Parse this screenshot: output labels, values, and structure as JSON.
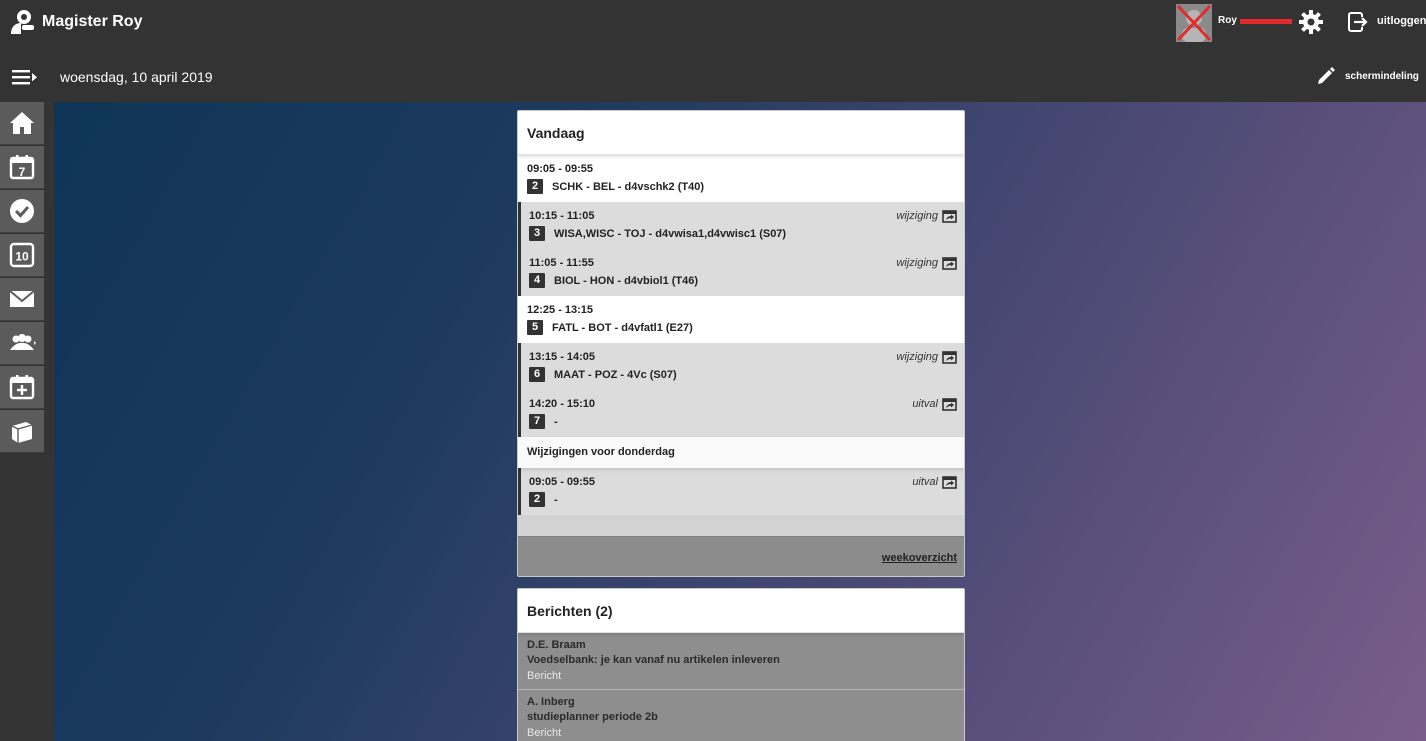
{
  "app": {
    "title": "Magister Roy"
  },
  "user": {
    "name": "Roy"
  },
  "header": {
    "logout_label": "uitloggen",
    "date": "woensdag, 10 april 2019",
    "layout_label": "schermindeling"
  },
  "sidebar": {
    "items": [
      {
        "icon": "home-icon"
      },
      {
        "icon": "calendar-7-icon"
      },
      {
        "icon": "check-icon"
      },
      {
        "icon": "grades-10-icon"
      },
      {
        "icon": "mail-icon"
      },
      {
        "icon": "group-icon"
      },
      {
        "icon": "calendar-add-icon"
      },
      {
        "icon": "bag-icon"
      }
    ]
  },
  "today": {
    "title": "Vandaag",
    "lessons": [
      {
        "time": "09:05 - 09:55",
        "hour": "2",
        "desc": "SCHK - BEL - d4vschk2 (T40)",
        "status": ""
      },
      {
        "time": "10:15 - 11:05",
        "hour": "3",
        "desc": "WISA,WISC - TOJ - d4vwisa1,d4vwisc1 (S07)",
        "status": "wijziging"
      },
      {
        "time": "11:05 - 11:55",
        "hour": "4",
        "desc": "BIOL - HON - d4vbiol1 (T46)",
        "status": "wijziging"
      },
      {
        "time": "12:25 - 13:15",
        "hour": "5",
        "desc": "FATL - BOT - d4vfatl1 (E27)",
        "status": ""
      },
      {
        "time": "13:15 - 14:05",
        "hour": "6",
        "desc": "MAAT - POZ - 4Vc (S07)",
        "status": "wijziging"
      },
      {
        "time": "14:20 - 15:10",
        "hour": "7",
        "desc": "-",
        "status": "uitval"
      }
    ],
    "next_day_title": "Wijzigingen voor donderdag",
    "next_day_lessons": [
      {
        "time": "09:05 - 09:55",
        "hour": "2",
        "desc": "-",
        "status": "uitval"
      }
    ],
    "week_link": "weekoverzicht"
  },
  "messages": {
    "title": "Berichten (2)",
    "items": [
      {
        "sender": "D.E. Braam",
        "subject": "Voedselbank: je kan vanaf nu artikelen inleveren",
        "kind": "Bericht"
      },
      {
        "sender": "A. Inberg",
        "subject": "studieplanner periode 2b",
        "kind": "Bericht"
      }
    ]
  },
  "colors": {
    "topbar": "#333333",
    "sidebar_item": "#5b5b5b",
    "gradient_start": "#0f3555",
    "gradient_end": "#7a5d8a",
    "changed_row": "#dcdcdc",
    "message_row": "#8e8e8e"
  }
}
